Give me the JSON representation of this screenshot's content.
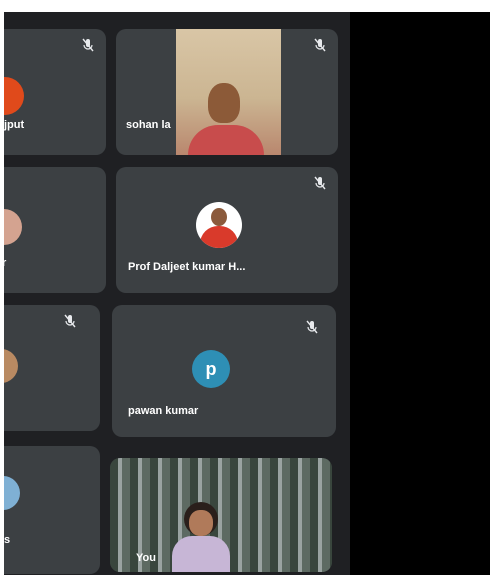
{
  "tiles": [
    {
      "name": "jput",
      "muted": true
    },
    {
      "name": "sohan la",
      "muted": true
    },
    {
      "name": "r",
      "muted": false
    },
    {
      "name": "Prof Daljeet kumar H...",
      "muted": true
    },
    {
      "name": "",
      "muted": true
    },
    {
      "name": "pawan kumar",
      "muted": true,
      "avatar_letter": "p"
    },
    {
      "name": "s",
      "muted": false
    },
    {
      "name": "You",
      "muted": false
    }
  ],
  "colors": {
    "tile_bg": "#3c4043",
    "grid_bg": "#1f2023",
    "avatar_blue": "#2e8fb5",
    "avatar_orange": "#e04a1b"
  },
  "icons": {
    "mute": "mic-off-icon"
  }
}
